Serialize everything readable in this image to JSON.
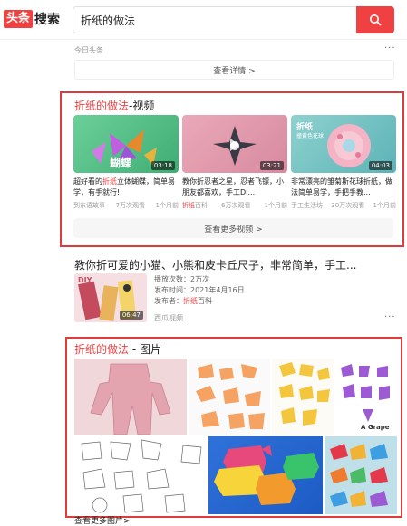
{
  "header": {
    "logo_badge": "头条",
    "logo_text": "搜索",
    "search_value": "折纸的做法"
  },
  "top_result": {
    "source": "今日头条",
    "more": "···",
    "detail_button": "查看详情 >"
  },
  "video_section": {
    "title_highlight": "折纸的做法",
    "title_rest": "-视频",
    "videos": [
      {
        "duration": "03:18",
        "thumb_text": "蝴蝶",
        "desc_pre": "超好看的",
        "desc_hl": "折纸",
        "desc_post": "立体蝴蝶，简单易学，有手就行!",
        "source": "到东语故事",
        "views": "7万次观看",
        "time": "1个月前"
      },
      {
        "duration": "03:21",
        "desc": "教你折忍者之星，忍者飞镖，小朋友都喜欢，手工DI...",
        "source_hl": "折纸",
        "source_rest": "百科",
        "views": "6万次观看",
        "time": "1个月前"
      },
      {
        "duration": "04:03",
        "thumb_text": "折纸",
        "thumb_sub": "撞黄色花球",
        "desc": "非常漂亮的雏菊斯花球折纸，做法简单易学，手把手教...",
        "source": "手工生活坊",
        "views": "30万次观看",
        "time": "1个月前"
      }
    ],
    "more_button": "查看更多视频 >"
  },
  "article": {
    "title": "教你折可爱的小猫、小熊和皮卡丘尺子，非常简单，手工...",
    "duration": "06:47",
    "thumb_text": "DIY",
    "play_count": "播放次数：2万次",
    "publish_time": "发布时间：2021年4月16日",
    "publisher_label": "发布者：",
    "publisher_hl": "折纸",
    "publisher_rest": "百科",
    "source": "西瓜视频",
    "more": "···"
  },
  "image_section": {
    "title_highlight": "折纸的做法",
    "title_rest": " - 图片",
    "tile_caption": "A Grape",
    "more_button": "查看更多图片>"
  },
  "colors": {
    "accent": "#f04142",
    "frame": "#e03b3b"
  }
}
